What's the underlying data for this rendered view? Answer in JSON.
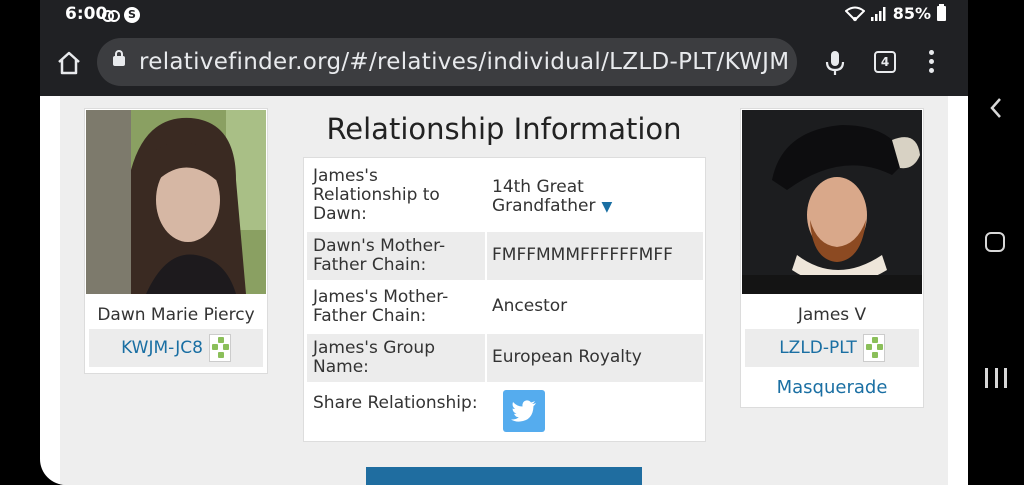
{
  "status_bar": {
    "time": "6:00",
    "s_badge": "S",
    "battery": "85%"
  },
  "browser": {
    "url": "relativefinder.org/#/relatives/individual/LZLD-PLT/KWJM-J",
    "tab_count": "4"
  },
  "page": {
    "title": "Relationship Information",
    "left_person": {
      "name": "Dawn Marie Piercy",
      "id": "KWJM-JC8"
    },
    "right_person": {
      "name": "James V",
      "id": "LZLD-PLT",
      "group_link": "Masquerade"
    },
    "rows": [
      {
        "label": "James's Relationship to Dawn:",
        "value": "14th Great Grandfather",
        "has_dropdown": true
      },
      {
        "label": "Dawn's Mother-Father Chain:",
        "value": "FMFFMMMFFFFFFMFF"
      },
      {
        "label": "James's Mother-Father Chain:",
        "value": "Ancestor"
      },
      {
        "label": "James's Group Name:",
        "value": "European Royalty"
      },
      {
        "label": "Share Relationship:",
        "value": ""
      }
    ],
    "dropdown_glyph": "▼"
  },
  "icons": {
    "twitter": "twitter-icon",
    "family_tree": "family-tree-icon"
  },
  "colors": {
    "link": "#1a6fa3",
    "twitter": "#55acee",
    "button": "#1f6da0"
  }
}
